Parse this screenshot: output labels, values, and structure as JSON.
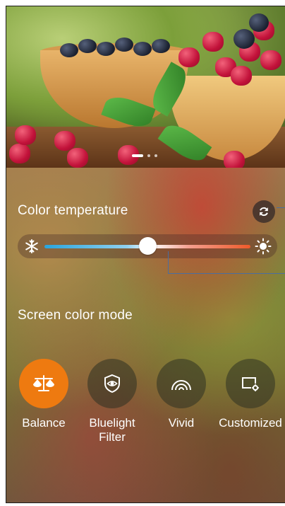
{
  "preview": {
    "pager_pages": 3,
    "pager_active_index": 0
  },
  "color_temperature": {
    "title": "Color temperature",
    "reset_icon": "reset-icon",
    "cool_icon": "snowflake-icon",
    "warm_icon": "sun-icon",
    "value": 0.5
  },
  "screen_color_mode": {
    "title": "Screen color mode",
    "selected": "Balance",
    "accent_color": "#ee7a10",
    "modes": [
      {
        "label": "Balance",
        "icon": "balance-scale-icon"
      },
      {
        "label": "Bluelight\nFilter",
        "icon": "eye-shield-icon"
      },
      {
        "label": "Vivid",
        "icon": "rainbow-icon"
      },
      {
        "label": "Customized",
        "icon": "monitor-settings-icon"
      }
    ]
  }
}
